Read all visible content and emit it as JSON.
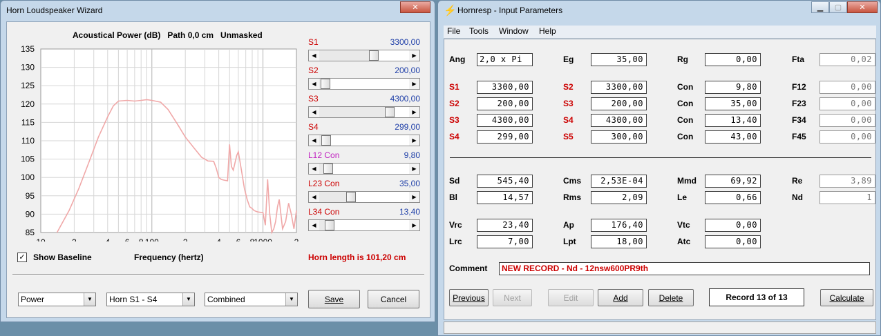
{
  "wizard": {
    "title": "Horn Loudspeaker Wizard",
    "chart_title": "Acoustical Power (dB)   Path 0,0 cm   Unmasked",
    "xlabel": "Frequency (hertz)",
    "show_baseline_label": "Show Baseline",
    "show_baseline_checked": "✓",
    "horn_length": "Horn length is 101,20 cm",
    "sliders": [
      {
        "label": "S1",
        "value": "3300,00",
        "fraction": 0.62
      },
      {
        "label": "S2",
        "value": "200,00",
        "fraction": 0.02
      },
      {
        "label": "S3",
        "value": "4300,00",
        "fraction": 0.82
      },
      {
        "label": "S4",
        "value": "299,00",
        "fraction": 0.03
      },
      {
        "label": "L12 Con",
        "value": "9,80",
        "fraction": 0.05
      },
      {
        "label": "L23 Con",
        "value": "35,00",
        "fraction": 0.34
      },
      {
        "label": "L34 Con",
        "value": "13,40",
        "fraction": 0.07
      }
    ],
    "combos": [
      "Power",
      "Horn S1 - S4",
      "Combined"
    ],
    "save_label": "Save",
    "cancel_label": "Cancel"
  },
  "chart_data": {
    "type": "line",
    "ylim": [
      85,
      135
    ],
    "yticks": [
      85,
      90,
      95,
      100,
      105,
      110,
      115,
      120,
      125,
      130,
      135
    ],
    "xlim": [
      10,
      2000
    ],
    "xscale": "log",
    "xtick_labels": [
      {
        "v": 10,
        "t": "10"
      },
      {
        "v": 20,
        "t": "2"
      },
      {
        "v": 40,
        "t": "4"
      },
      {
        "v": 60,
        "t": "6"
      },
      {
        "v": 80,
        "t": "8"
      },
      {
        "v": 100,
        "t": "100"
      },
      {
        "v": 200,
        "t": "2"
      },
      {
        "v": 400,
        "t": "4"
      },
      {
        "v": 600,
        "t": "6"
      },
      {
        "v": 800,
        "t": "8"
      },
      {
        "v": 1000,
        "t": "1000"
      },
      {
        "v": 2000,
        "t": "2"
      }
    ],
    "grid": true,
    "line_color": "#f0a8a8",
    "x": [
      14,
      18,
      22,
      27,
      33,
      40,
      45,
      50,
      60,
      70,
      80,
      90,
      100,
      120,
      140,
      170,
      200,
      240,
      280,
      320,
      360,
      380,
      400,
      420,
      440,
      460,
      480,
      500,
      520,
      540,
      560,
      580,
      600,
      640,
      680,
      720,
      760,
      800,
      830,
      860,
      900,
      940,
      1000,
      1050,
      1100,
      1150,
      1200,
      1250,
      1300,
      1350,
      1400,
      1450,
      1500,
      1600,
      1700,
      1800,
      1900,
      2000
    ],
    "y": [
      85,
      91,
      97,
      104,
      111,
      116.5,
      119.5,
      120.8,
      121,
      120.8,
      121,
      121.2,
      121,
      120.5,
      118.5,
      114.5,
      111,
      108,
      105.5,
      104.5,
      104.4,
      102.5,
      100,
      99.5,
      99.3,
      99.2,
      99.1,
      109,
      103,
      102,
      104,
      106,
      107,
      102,
      97,
      94,
      92,
      91.5,
      91,
      90.8,
      90.6,
      90.5,
      90.4,
      87,
      99.5,
      90,
      85,
      86,
      88,
      92,
      94,
      90,
      86,
      88,
      93,
      90,
      86,
      91
    ]
  },
  "hornresp": {
    "title": "Hornresp - Input Parameters",
    "menu": [
      "File",
      "Tools",
      "Window",
      "Help"
    ],
    "rows": [
      [
        [
          "Ang",
          "2,0 x Pi"
        ],
        [
          "Eg",
          "35,00"
        ],
        [
          "Rg",
          "0,00"
        ],
        [
          "Fta",
          "0,02"
        ]
      ],
      [
        [
          "S1",
          "3300,00"
        ],
        [
          "S2",
          "3300,00"
        ],
        [
          "Con",
          "9,80"
        ],
        [
          "F12",
          "0,00"
        ]
      ],
      [
        [
          "S2",
          "200,00"
        ],
        [
          "S3",
          "200,00"
        ],
        [
          "Con",
          "35,00"
        ],
        [
          "F23",
          "0,00"
        ]
      ],
      [
        [
          "S3",
          "4300,00"
        ],
        [
          "S4",
          "4300,00"
        ],
        [
          "Con",
          "13,40"
        ],
        [
          "F34",
          "0,00"
        ]
      ],
      [
        [
          "S4",
          "299,00"
        ],
        [
          "S5",
          "300,00"
        ],
        [
          "Con",
          "43,00"
        ],
        [
          "F45",
          "0,00"
        ]
      ],
      [
        [
          "Sd",
          "545,40"
        ],
        [
          "Cms",
          "2,53E-04"
        ],
        [
          "Mmd",
          "69,92"
        ],
        [
          "Re",
          "3,89"
        ]
      ],
      [
        [
          "Bl",
          "14,57"
        ],
        [
          "Rms",
          "2,09"
        ],
        [
          "Le",
          "0,66"
        ],
        [
          "Nd",
          "1"
        ]
      ],
      [
        [
          "Vrc",
          "23,40"
        ],
        [
          "Ap",
          "176,40"
        ],
        [
          "Vtc",
          "0,00"
        ]
      ],
      [
        [
          "Lrc",
          "7,00"
        ],
        [
          "Lpt",
          "18,00"
        ],
        [
          "Atc",
          "0,00"
        ]
      ]
    ],
    "comment_label": "Comment",
    "comment_value": "NEW RECORD - Nd - 12nsw600PR9th",
    "buttons": {
      "previous": "Previous",
      "next": "Next",
      "edit": "Edit",
      "add": "Add",
      "delete": "Delete",
      "record": "Record 13 of 13",
      "calculate": "Calculate"
    }
  }
}
